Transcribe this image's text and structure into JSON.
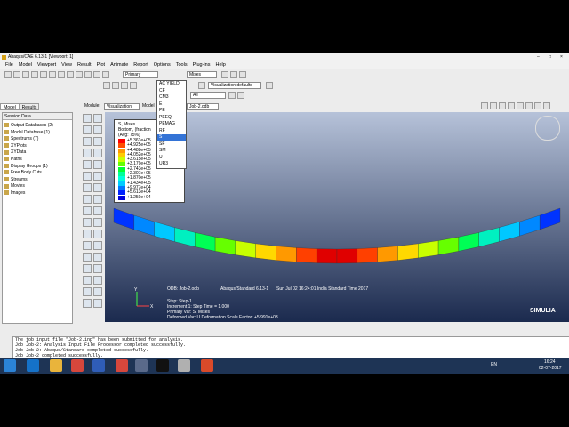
{
  "window": {
    "title": "Abaqus/CAE 6.13-1 [Viewport: 1]"
  },
  "menu": [
    "File",
    "Model",
    "Viewport",
    "View",
    "Result",
    "Plot",
    "Animate",
    "Report",
    "Options",
    "Tools",
    "Plug-ins",
    "Help"
  ],
  "toolbar": {
    "primary_combo": "Primary",
    "invariant_combo": "Mises",
    "viz_defaults": "Visualization defaults",
    "all_combo": "All",
    "module_label": "Module:",
    "module_value": "Visualization",
    "model_label": "Model",
    "model_value": "Job-2.odb"
  },
  "variable_dropdown": {
    "items": [
      "AC YIELD",
      "CF",
      "CM3",
      "E",
      "PE",
      "PEEQ",
      "PEMAG",
      "RF",
      "S",
      "SF",
      "SM",
      "U",
      "UR3"
    ],
    "selected": "S"
  },
  "tabs": [
    "Model",
    "Results"
  ],
  "session_data": "Session Data",
  "tree": [
    "Output Databases (2)",
    "Model Database (1)",
    "Spectrums (7)",
    "XYPlots",
    "XYData",
    "Paths",
    "Display Groups (1)",
    "Free Body Cuts",
    "Streams",
    "Movies",
    "Images"
  ],
  "legend": {
    "title1": "S, Mises",
    "title2": "Bottom, (fraction",
    "title3": "(Avg: 75%)",
    "values": [
      "+5.361e+05",
      "+4.925e+05",
      "+4.488e+05",
      "+4.052e+05",
      "+3.615e+05",
      "+3.179e+05",
      "+2.743e+05",
      "+2.307e+05",
      "+1.870e+05",
      "+1.434e+05",
      "+9.977e+04",
      "+5.613e+04",
      "+1.250e+04"
    ],
    "colors": [
      "#ff0000",
      "#ff4d00",
      "#ff9900",
      "#ffcc00",
      "#ccff00",
      "#66ff00",
      "#00ff33",
      "#00ff99",
      "#00ffdd",
      "#00ccff",
      "#0077ff",
      "#0022ff",
      "#0000dd"
    ]
  },
  "viewport_info": {
    "odb": "ODB: Job-2.odb",
    "solver": "Abaqus/Standard 6.13-1",
    "date": "Sun Jul 02 16:24:01 India Standard Time 2017",
    "step": "Step: Step-1",
    "increment": "Increment     1: Step Time =     1.000",
    "primary": "Primary Var: S, Mises",
    "deformed": "Deformed Var: U   Deformation Scale Factor: +5.991e+03"
  },
  "brand": "SIMULIA",
  "messages": [
    "The job input file \"Job-2.inp\" has been submitted for analysis.",
    "Job Job-2: Analysis Input File Processor completed successfully.",
    "Job Job-2: Abaqus/Standard completed successfully.",
    "Job Job-2 completed successfully."
  ],
  "taskbar": {
    "lang": "EN",
    "time": "16:24",
    "date": "02-07-2017"
  },
  "beam_colors": [
    "#0033ff",
    "#0088ff",
    "#00c8ff",
    "#00f0c0",
    "#00ff55",
    "#66ff00",
    "#c8ff00",
    "#ffd800",
    "#ff9900",
    "#ff4000",
    "#e00000",
    "#e00000",
    "#ff4000",
    "#ff9900",
    "#ffd800",
    "#c8ff00",
    "#66ff00",
    "#00ff55",
    "#00f0c0",
    "#00c8ff",
    "#0088ff",
    "#0033ff"
  ]
}
